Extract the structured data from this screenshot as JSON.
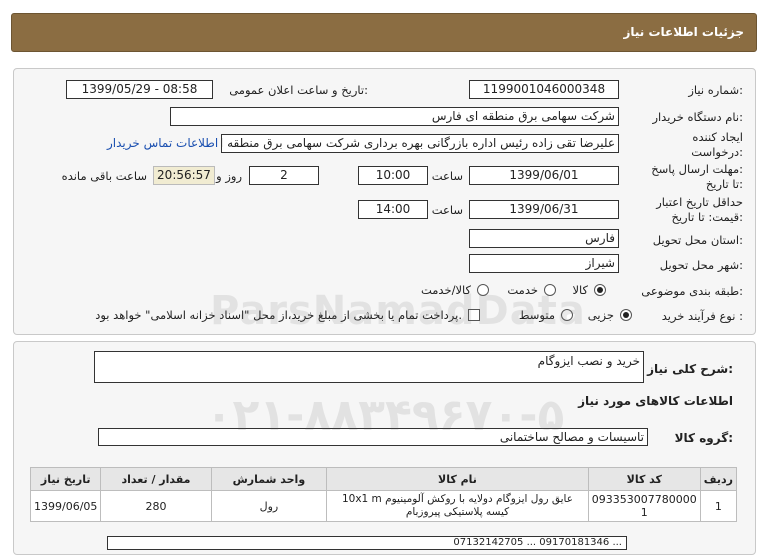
{
  "header": {
    "title": "جزئیات اطلاعات نیاز"
  },
  "form": {
    "need_number_label": "شماره نیاز:",
    "need_number": "1199001046000348",
    "announce_label": "تاریخ و ساعت اعلان عمومی:",
    "announce_value": "1399/05/29 - 08:58",
    "buyer_org_label": "نام دستگاه خریدار:",
    "buyer_org": "شرکت سهامی برق منطقه ای فارس",
    "creator_label_1": "ایجاد کننده",
    "creator_label_2": "درخواست:",
    "creator": "علیرضا  تقی زاده رئیس اداره بازرگانی بهره برداری شرکت سهامی برق منطقه ای فارس",
    "contact_link": "اطلاعات تماس خریدار",
    "deadline_label_1": "مهلت ارسال پاسخ:",
    "deadline_label_2": "تا تاریخ:",
    "deadline_date": "1399/06/01",
    "time_label": "ساعت",
    "deadline_time": "10:00",
    "days_value": "2",
    "days_label": "روز و",
    "remaining_time": "20:56:57",
    "remaining_label": "ساعت باقی مانده",
    "validity_label_1": "حداقل تاریخ اعتبار",
    "validity_label_2": "قیمت: تا تاریخ:",
    "validity_date": "1399/06/31",
    "validity_time_label": "ساعت",
    "validity_time": "14:00",
    "province_label": "استان محل تحویل:",
    "province": "فارس",
    "city_label": "شهر محل تحویل:",
    "city": "شیراز",
    "category_label": "طبقه بندی موضوعی:",
    "category_options": [
      "کالا",
      "خدمت",
      "کالا/خدمت"
    ],
    "category_selected": 0,
    "process_label": "نوع فرآیند خرید :",
    "process_options": [
      "جزیی",
      "متوسط"
    ],
    "process_selected": 0,
    "payment_note": "پرداخت تمام یا بخشی از مبلغ خرید،از محل \"اسناد خزانه اسلامی\" خواهد بود."
  },
  "summary": {
    "desc_label": "شرح کلی نیاز:",
    "desc_value": "خرید و نصب ایزوگام",
    "items_title": "اطلاعات کالاهای مورد نیاز",
    "group_label": "گروه کالا:",
    "group_value": "تاسیسات و مصالح ساختمانی"
  },
  "table": {
    "headers": [
      "ردیف",
      "کد کالا",
      "نام کالا",
      "واحد شمارش",
      "مقدار / تعداد",
      "تاریخ نیاز"
    ],
    "rows": [
      [
        "1",
        "093353007780000 1",
        "عایق رول ایزوگام دولایه با روکش آلومینیوم 10x1 m کیسه پلاستیکی پیروزبام",
        "رول",
        "280",
        "1399/06/05"
      ]
    ]
  },
  "footer_text": "07132142705 ... 09170181346 ...",
  "watermark": {
    "name": "ParsNamadData",
    "phone": "۰۲۱-۸۸۳۴۹۶۷۰-۵"
  },
  "colors": {
    "header_bg": "#8b6d42",
    "link": "#1a4fb0",
    "timer_bg": "#f1ecd2"
  }
}
